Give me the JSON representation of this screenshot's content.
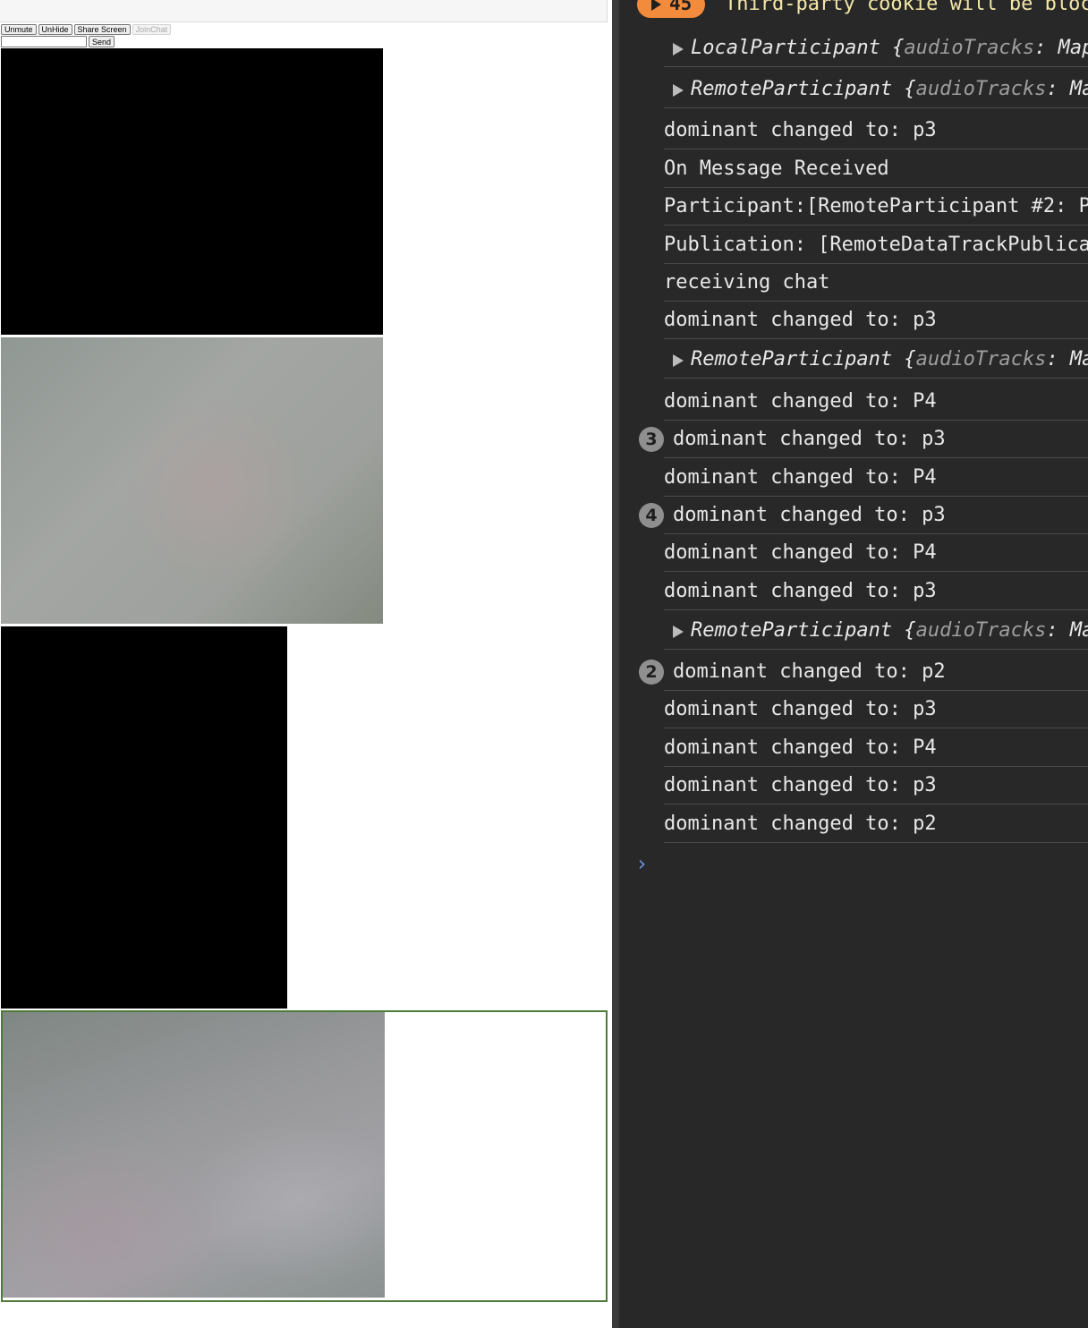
{
  "page": {
    "buttons": [
      "Unmute",
      "UnHide",
      "Share Screen",
      "JoinChat"
    ],
    "chat_placeholder": "",
    "send_label": "Send"
  },
  "console": {
    "warning": {
      "count": "45",
      "text": "Third-party cookie will be bloc"
    },
    "entries": [
      {
        "text": "LocalParticipant {audioTracks: Map"
      },
      {
        "text": "RemoteParticipant {audioTracks: Ma"
      },
      {
        "text": "dominant changed to:  p3"
      },
      {
        "text": "On Message Received"
      },
      {
        "text": "Participant:[RemoteParticipant #2: P"
      },
      {
        "text": "Publication: [RemoteDataTrackPublica"
      },
      {
        "text": "receiving chat"
      },
      {
        "text": "dominant changed to:  p3"
      },
      {
        "text": "RemoteParticipant {audioTracks: Ma"
      },
      {
        "text": "dominant changed to:  P4"
      },
      {
        "text": "dominant changed to:  p3",
        "repeat": "3"
      },
      {
        "text": "dominant changed to:  P4"
      },
      {
        "text": "dominant changed to:  p3",
        "repeat": "4"
      },
      {
        "text": "dominant changed to:  P4"
      },
      {
        "text": "dominant changed to:  p3"
      },
      {
        "text": "RemoteParticipant {audioTracks: Ma"
      },
      {
        "text": "dominant changed to:  p2",
        "repeat": "2"
      },
      {
        "text": "dominant changed to:  p3"
      },
      {
        "text": "dominant changed to:  P4"
      },
      {
        "text": "dominant changed to:  p3"
      },
      {
        "text": "dominant changed to:  p2"
      }
    ],
    "prompt": "›"
  }
}
